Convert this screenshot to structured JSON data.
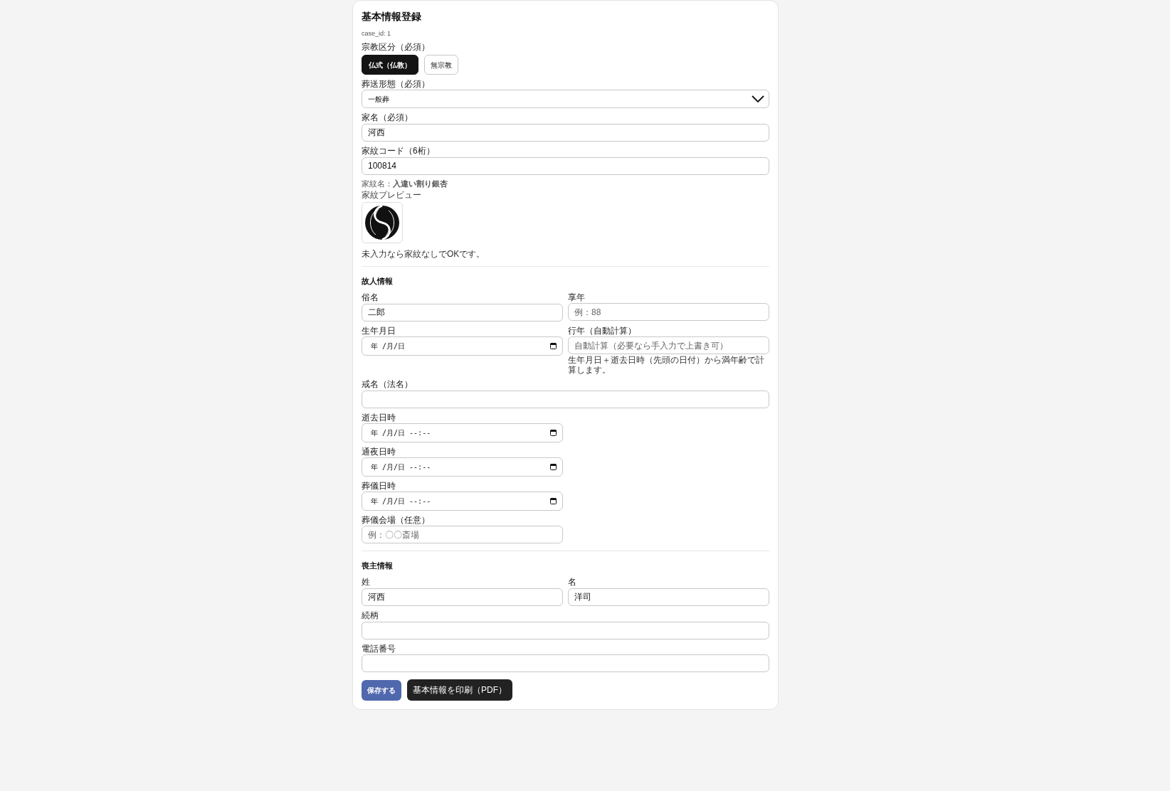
{
  "title": "基本情報登録",
  "case_id": "case_id: 1",
  "religion": {
    "label": "宗教区分（必須）",
    "options": [
      {
        "label": "仏式（仏教）",
        "selected": true
      },
      {
        "label": "無宗教",
        "selected": false
      }
    ]
  },
  "funeral_type": {
    "label": "葬送形態（必須）",
    "value": "一般葬"
  },
  "family_name": {
    "label": "家名（必須）",
    "value": "河西"
  },
  "crest_code": {
    "label": "家紋コード（6桁）",
    "value": "100814"
  },
  "crest_name": "家紋名：**入違い割り銀杏**",
  "crest_preview_label": "家紋プレビュー",
  "crest_note": "未入力なら家紋なしでOKです。",
  "sections": [
    {
      "title": "故人情報",
      "rows": [
        {
          "kind": "pair",
          "fields": [
            {
              "kind": "text",
              "label": "俗名",
              "value": "二郎"
            },
            {
              "kind": "text",
              "label": "享年",
              "placeholder": "例：88"
            }
          ]
        },
        {
          "kind": "pair",
          "fields": [
            {
              "kind": "date",
              "label": "生年月日",
              "value": "年 /月/日"
            },
            {
              "kind": "text",
              "label": "行年（自動計算）",
              "placeholder": "自動計算（必要なら手入力で上書き可）",
              "hint": "生年月日＋逝去日時（先頭の日付）から満年齢で計算します。"
            }
          ]
        },
        {
          "kind": "full",
          "fields": [
            {
              "kind": "text",
              "label": "戒名（法名）"
            }
          ]
        },
        {
          "kind": "pair",
          "fields": [
            {
              "kind": "date",
              "label": "逝去日時",
              "value": "年 /月/日 --:--"
            }
          ]
        },
        {
          "kind": "pair",
          "fields": [
            {
              "kind": "date",
              "label": "通夜日時",
              "value": "年 /月/日 --:--"
            }
          ]
        },
        {
          "kind": "pair",
          "fields": [
            {
              "kind": "date",
              "label": "葬儀日時",
              "value": "年 /月/日 --:--"
            }
          ]
        },
        {
          "kind": "pair",
          "fields": [
            {
              "kind": "text",
              "label": "葬儀会場（任意）",
              "placeholder": "例：〇〇斎場"
            }
          ]
        }
      ]
    },
    {
      "title": "喪主情報",
      "rows": [
        {
          "kind": "pair",
          "fields": [
            {
              "kind": "text",
              "label": "姓",
              "value": "河西"
            },
            {
              "kind": "text",
              "label": "名",
              "value": "洋司"
            }
          ]
        },
        {
          "kind": "full",
          "fields": [
            {
              "kind": "text",
              "label": "続柄"
            }
          ]
        },
        {
          "kind": "full",
          "fields": [
            {
              "kind": "text",
              "label": "電話番号"
            }
          ]
        }
      ]
    }
  ],
  "buttons": [
    {
      "kind": "primary",
      "label": "保存する"
    },
    {
      "kind": "dark",
      "label": "基本情報を印刷（PDF）"
    }
  ]
}
